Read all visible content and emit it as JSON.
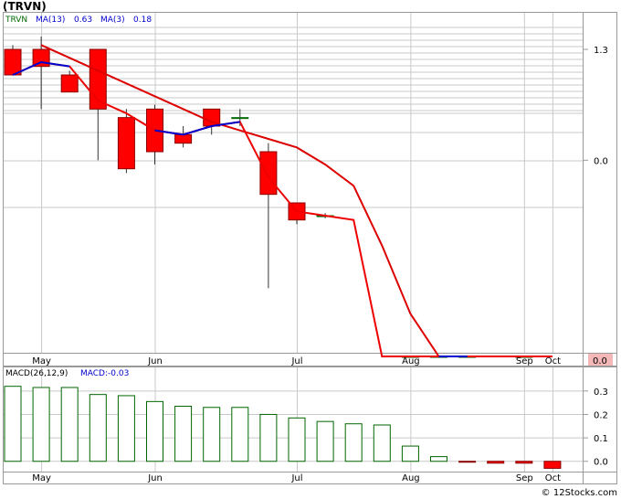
{
  "ticker_title": "(TRVN)",
  "credit": "© 12Stocks.com",
  "chart_data": [
    {
      "type": "candlestick",
      "legend": {
        "symbol": "TRVN",
        "ma13_label": "MA(13)",
        "ma13_value": "0.63",
        "ma3_label": "MA(3)",
        "ma3_value": "0.18"
      },
      "y_tick_labels": [
        "1.3",
        "0.0"
      ],
      "ylim": [
        -2.3,
        1.6
      ],
      "last_price_label": "0.0",
      "x_tick_labels": [
        "May",
        "Jun",
        "Jul",
        "Aug",
        "Sep",
        "Oct"
      ],
      "x_tick_index": [
        1,
        5,
        10,
        14,
        18,
        19
      ],
      "candles": [
        {
          "o": 1.3,
          "c": 1.0,
          "h": 1.35,
          "l": 1.0
        },
        {
          "o": 1.3,
          "c": 1.1,
          "h": 1.45,
          "l": 0.6
        },
        {
          "o": 1.0,
          "c": 0.8,
          "h": 1.05,
          "l": 0.8
        },
        {
          "o": 1.3,
          "c": 0.6,
          "h": 1.3,
          "l": 0.0
        },
        {
          "o": 0.5,
          "c": -0.1,
          "h": 0.6,
          "l": -0.15
        },
        {
          "o": 0.6,
          "c": 0.1,
          "h": 0.65,
          "l": -0.05
        },
        {
          "o": 0.3,
          "c": 0.2,
          "h": 0.4,
          "l": 0.15
        },
        {
          "o": 0.6,
          "c": 0.4,
          "h": 0.6,
          "l": 0.3
        },
        {
          "o": 0.5,
          "c": 0.5,
          "h": 0.6,
          "l": 0.4
        },
        {
          "o": 0.1,
          "c": -0.4,
          "h": 0.2,
          "l": -1.5
        },
        {
          "o": -0.5,
          "c": -0.7,
          "h": -0.5,
          "l": -0.75
        },
        {
          "o": -0.65,
          "c": -0.65,
          "h": -0.62,
          "l": -0.68
        },
        null,
        null,
        {
          "o": -7.7,
          "c": -7.7,
          "h": -7.7,
          "l": -7.7
        },
        {
          "o": -7.6,
          "c": -7.0,
          "h": -7.0,
          "l": -7.6
        },
        {
          "o": -7.3,
          "c": -7.3,
          "h": -7.3,
          "l": -7.3
        },
        null,
        {
          "o": -7.6,
          "c": -7.6,
          "h": -7.6,
          "l": -7.6
        },
        null
      ],
      "ma13": [
        null,
        1.35,
        1.2,
        1.05,
        0.9,
        0.75,
        0.6,
        0.45,
        0.35,
        0.25,
        0.15,
        -0.05,
        -0.3,
        -1.0,
        -1.8,
        -2.5,
        -3.1,
        -3.6,
        -4.2,
        -4.9
      ],
      "ma3": [
        1.0,
        1.15,
        1.1,
        0.7,
        0.55,
        0.35,
        0.3,
        0.4,
        0.45,
        -0.2,
        -0.6,
        -0.65,
        -0.7,
        -3.5,
        -5.7,
        -7.4,
        -7.3,
        -7.2,
        -7.4,
        -11.0
      ],
      "ma3_blue_segments": [
        [
          0,
          2
        ],
        [
          5,
          8
        ],
        [
          15,
          16
        ]
      ]
    },
    {
      "type": "bar",
      "title": "MACD(26,12,9)",
      "value_label": "MACD:-0.03",
      "y_tick_labels": [
        "0.3",
        "0.2",
        "0.1",
        "0.0"
      ],
      "y_ticks": [
        0.3,
        0.2,
        0.1,
        0.0
      ],
      "ylim": [
        -0.04,
        0.35
      ],
      "x_tick_labels": [
        "May",
        "Jun",
        "Jul",
        "Aug",
        "Sep",
        "Oct"
      ],
      "x_tick_index": [
        1,
        5,
        10,
        14,
        18,
        19
      ],
      "values": [
        0.32,
        0.315,
        0.315,
        0.285,
        0.28,
        0.255,
        0.235,
        0.23,
        0.23,
        0.2,
        0.185,
        0.17,
        0.16,
        0.155,
        0.065,
        0.02,
        -0.003,
        -0.008,
        -0.008,
        -0.03
      ]
    }
  ]
}
